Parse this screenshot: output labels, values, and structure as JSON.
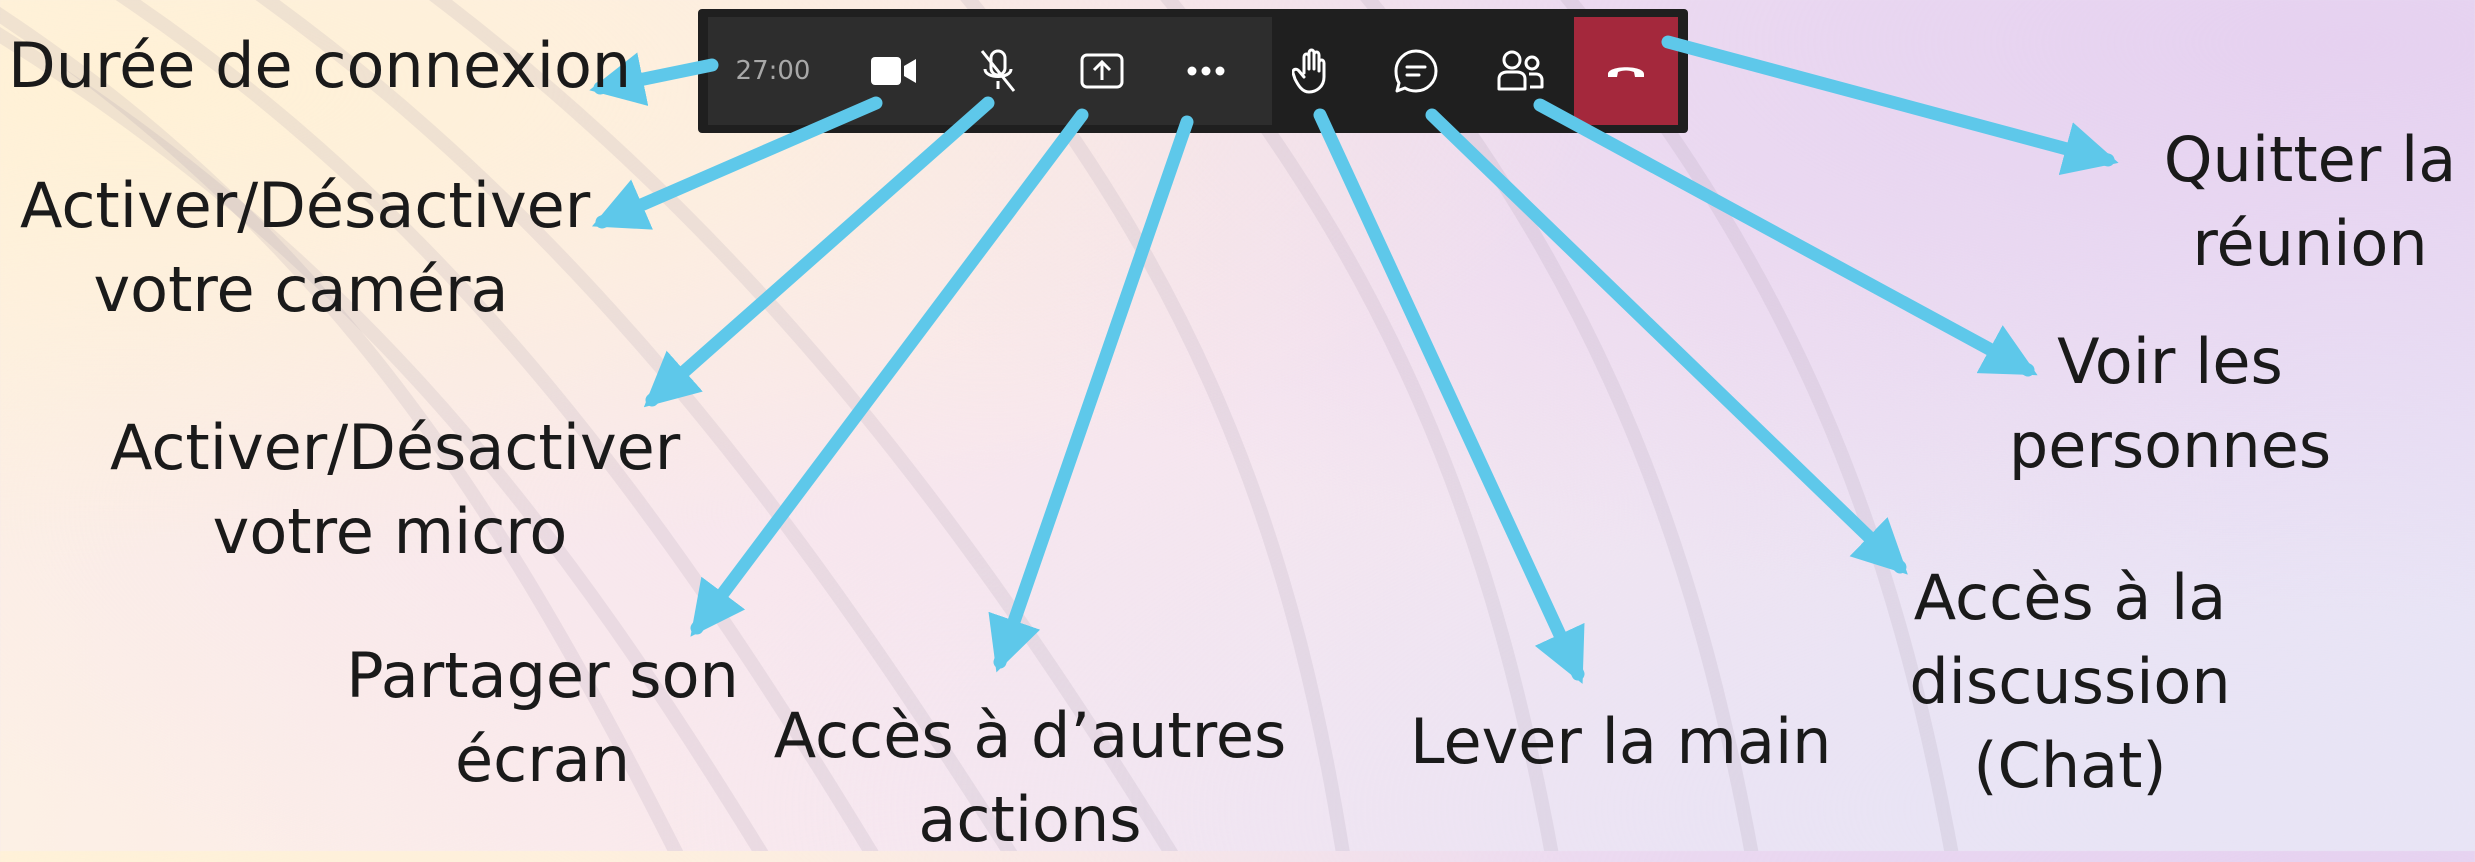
{
  "toolbar": {
    "timer": "27:00",
    "buttons": [
      {
        "id": "camera",
        "icon": "video-camera-icon"
      },
      {
        "id": "microphone",
        "icon": "microphone-off-icon"
      },
      {
        "id": "share",
        "icon": "share-screen-icon"
      },
      {
        "id": "more",
        "icon": "more-actions-icon"
      },
      {
        "id": "raise-hand",
        "icon": "raise-hand-icon"
      },
      {
        "id": "chat",
        "icon": "chat-icon"
      },
      {
        "id": "people",
        "icon": "people-icon"
      },
      {
        "id": "leave",
        "icon": "hang-up-icon"
      }
    ],
    "colors": {
      "bar": "#1f1f1f",
      "group": "#2d2d2d",
      "leave": "#a4283c",
      "icon": "#ffffff",
      "timer": "#a8a8a8"
    }
  },
  "annotations": {
    "duration": {
      "lines": [
        "Durée de connexion"
      ]
    },
    "camera": {
      "lines": [
        "Activer/Désactiver",
        "votre caméra"
      ]
    },
    "microphone": {
      "lines": [
        "Activer/Désactiver",
        "votre micro"
      ]
    },
    "share": {
      "lines": [
        "Partager son",
        "écran"
      ]
    },
    "more": {
      "lines": [
        "Accès à d’autres",
        "actions"
      ]
    },
    "raise_hand": {
      "lines": [
        "Lever la main"
      ]
    },
    "chat": {
      "lines": [
        "Accès à la",
        "discussion",
        "(Chat)"
      ]
    },
    "people": {
      "lines": [
        "Voir les",
        "personnes"
      ]
    },
    "leave": {
      "lines": [
        "Quitter la",
        "réunion"
      ]
    }
  },
  "arrow_color": "#5ec8ea"
}
